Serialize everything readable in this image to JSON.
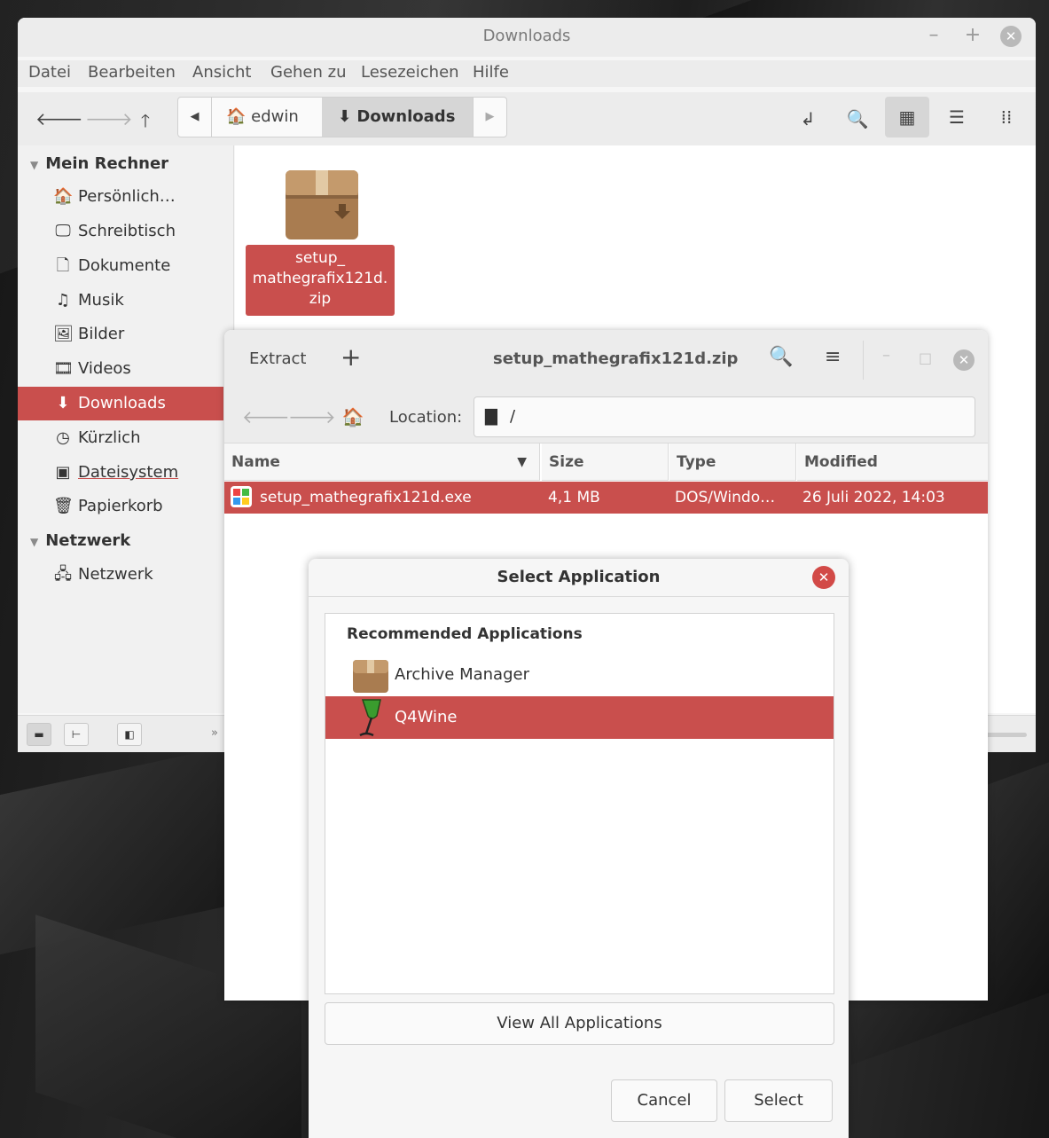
{
  "file_manager": {
    "title": "Downloads",
    "menu": [
      "Datei",
      "Bearbeiten",
      "Ansicht",
      "Gehen zu",
      "Lesezeichen",
      "Hilfe"
    ],
    "path": [
      "edwin",
      "Downloads"
    ],
    "sidebar": {
      "section1": "Mein Rechner",
      "items": [
        {
          "label": "Persönlich…",
          "icon": "home-icon"
        },
        {
          "label": "Schreibtisch",
          "icon": "desktop-icon"
        },
        {
          "label": "Dokumente",
          "icon": "documents-icon"
        },
        {
          "label": "Musik",
          "icon": "music-icon"
        },
        {
          "label": "Bilder",
          "icon": "pictures-icon"
        },
        {
          "label": "Videos",
          "icon": "videos-icon"
        },
        {
          "label": "Downloads",
          "icon": "downloads-icon"
        },
        {
          "label": "Kürzlich",
          "icon": "recent-icon"
        },
        {
          "label": "Dateisystem",
          "icon": "filesystem-icon"
        },
        {
          "label": "Papierkorb",
          "icon": "trash-icon"
        }
      ],
      "section2": "Netzwerk",
      "network_items": [
        {
          "label": "Netzwerk",
          "icon": "network-icon"
        }
      ]
    },
    "file": {
      "name": "setup_\nmathegrafix121d.\nzip"
    }
  },
  "archive_manager": {
    "extract_label": "Extract",
    "title": "setup_mathegrafix121d.zip",
    "location_label": "Location:",
    "location_value": "/",
    "columns": [
      "Name",
      "Size",
      "Type",
      "Modified"
    ],
    "rows": [
      {
        "name": "setup_mathegrafix121d.exe",
        "size": "4,1 MB",
        "type": "DOS/Windo…",
        "modified": "26 Juli 2022, 14:03"
      }
    ]
  },
  "select_dialog": {
    "title": "Select Application",
    "section": "Recommended Applications",
    "apps": [
      {
        "name": "Archive Manager",
        "icon": "archive-manager-icon"
      },
      {
        "name": "Q4Wine",
        "icon": "q4wine-icon"
      }
    ],
    "view_all_label": "View All Applications",
    "cancel_label": "Cancel",
    "select_label": "Select"
  },
  "colors": {
    "accent": "#c94f4d",
    "window_bg": "#ececec",
    "close_red": "#d24a47"
  }
}
